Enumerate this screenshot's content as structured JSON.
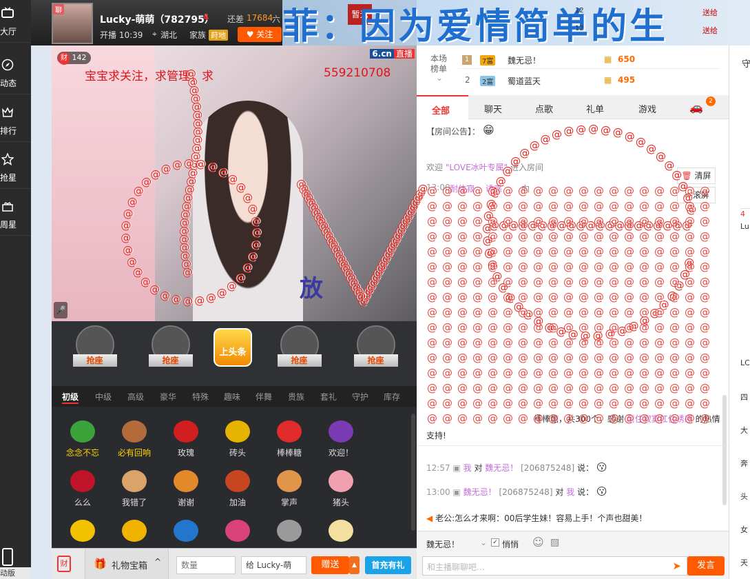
{
  "sidebar": {
    "items": [
      {
        "label": "大厅",
        "icon": "tv-icon"
      },
      {
        "label": "动态",
        "icon": "compass-icon"
      },
      {
        "label": "排行",
        "icon": "crown-icon"
      },
      {
        "label": "抢星",
        "icon": "star-icon"
      },
      {
        "label": "周星",
        "icon": "gift-box-icon"
      }
    ],
    "bottom_label": "动版"
  },
  "host": {
    "badge": "聊",
    "name": "Lucky-萌萌（782795）",
    "level_tag": "4",
    "diff_prefix": "还差",
    "diff_value": "17684",
    "diff_suffix": "六",
    "start_time": "开播 10:39",
    "location": "湖北",
    "family_label": "家族",
    "family_tag": "莳地",
    "follow_label": "关注"
  },
  "marquee": {
    "text": "菲：因为爱情简单的生",
    "badge": "暂无"
  },
  "video": {
    "viewer_icon": "财",
    "viewer_count": "142",
    "site_logo": "6.cn",
    "live_label": "直播",
    "caption": "宝宝求关注，求管理，求",
    "caption_tail": "559210708",
    "stage_sign": "放"
  },
  "seats": {
    "grab_label": "抢座",
    "headline_label": "上头条"
  },
  "gift_tabs": [
    "初级",
    "中级",
    "高级",
    "豪华",
    "特殊",
    "趣味",
    "伴舞",
    "贵族",
    "套礼",
    "守护",
    "库存"
  ],
  "gifts": [
    {
      "label": "念念不忘",
      "color": "#3aa33a",
      "highlight": true
    },
    {
      "label": "必有回响",
      "color": "#b36b3c",
      "highlight": true
    },
    {
      "label": "玫瑰",
      "color": "#d11f1f",
      "highlight": false
    },
    {
      "label": "砖头",
      "color": "#e6b400",
      "highlight": false
    },
    {
      "label": "棒棒糖",
      "color": "#e22b2b",
      "highlight": false
    },
    {
      "label": "欢迎！",
      "color": "#7a3bb5",
      "highlight": false
    },
    {
      "label": "么么",
      "color": "#c0142a",
      "highlight": false
    },
    {
      "label": "我错了",
      "color": "#d9a36a",
      "highlight": false
    },
    {
      "label": "谢谢",
      "color": "#e28a2a",
      "highlight": false
    },
    {
      "label": "加油",
      "color": "#c8461f",
      "highlight": false
    },
    {
      "label": "掌声",
      "color": "#e0954a",
      "highlight": false
    },
    {
      "label": "猪头",
      "color": "#f0a0b0",
      "highlight": false
    },
    {
      "label": "",
      "color": "#f2c200",
      "highlight": false
    },
    {
      "label": "",
      "color": "#f0b400",
      "highlight": false
    },
    {
      "label": "",
      "color": "#2277cc",
      "highlight": false
    },
    {
      "label": "",
      "color": "#d9437a",
      "highlight": false
    },
    {
      "label": "",
      "color": "#9a9a9a",
      "highlight": false
    },
    {
      "label": "",
      "color": "#f3e0a0",
      "highlight": false
    }
  ],
  "bottom": {
    "treasure_icon": "财",
    "gift_box_label": "礼物宝箱",
    "qty_placeholder": "数量",
    "recipient_prefix": "给",
    "recipient_value": "Lucky-萌",
    "send_label": "赠送",
    "recharge_label": "首充有礼"
  },
  "rank": {
    "label_line1": "本场",
    "label_line2": "榜单",
    "rows": [
      {
        "pos": "1",
        "level": "7富",
        "name": "魏无忌！",
        "score": "650"
      },
      {
        "pos": "2",
        "level": "2富",
        "name": "蜀道蓝天",
        "score": "495"
      }
    ]
  },
  "chat_tabs": [
    "全部",
    "聊天",
    "点歌",
    "礼单",
    "游戏"
  ],
  "chat_tab_badge": "2",
  "chat": {
    "notice_label": "【房间公告】：",
    "welcome_prefix": "欢迎",
    "welcome_name": "\"LOVE冰叶专属\"",
    "welcome_suffix": "进入房间",
    "clear_label": "清屏",
    "scroll_label": "滚屏",
    "msg1_time": "13:00",
    "msg1_name": "耐住寂",
    "msg1_name2": "诱惑",
    "msg1_tail": "向",
    "gift_text_a": "棒棒糖，共300个，感谢",
    "gift_text_name": "耐住寂寞扛住诱惑",
    "gift_text_b": "的热情",
    "gift_text_c": "支持!",
    "msg2_time": "12:57",
    "msg2_from": "我",
    "msg2_to_word": "对",
    "msg2_to": "魏无忌！",
    "msg2_id": "[206875248]",
    "msg2_says": "说：",
    "msg3_time": "13:00",
    "msg3_from": "魏无忌！",
    "msg3_id": "[206875248]",
    "msg3_to_word": "对",
    "msg3_to": "我",
    "msg3_says": "说：",
    "ad_text": "老公:怎么才来啊：00后学生妹！容易上手！个声也甜美！"
  },
  "input": {
    "target_name": "魏无忌！",
    "whisper_label": "悄悄",
    "placeholder": "和主播聊聊吧...",
    "send_label": "发言"
  },
  "top_right_ticker": [
    {
      "time": "12",
      "action": "送给"
    },
    {
      "time": "12",
      "action": "送给"
    }
  ],
  "far_right": {
    "header": "守",
    "items": [
      "Lu",
      "4",
      "LC",
      "四",
      "大",
      "奔",
      "头",
      "女",
      "天"
    ]
  },
  "overlay": {
    "word": "love",
    "colors": {
      "lollipop": "#e5261f"
    }
  }
}
